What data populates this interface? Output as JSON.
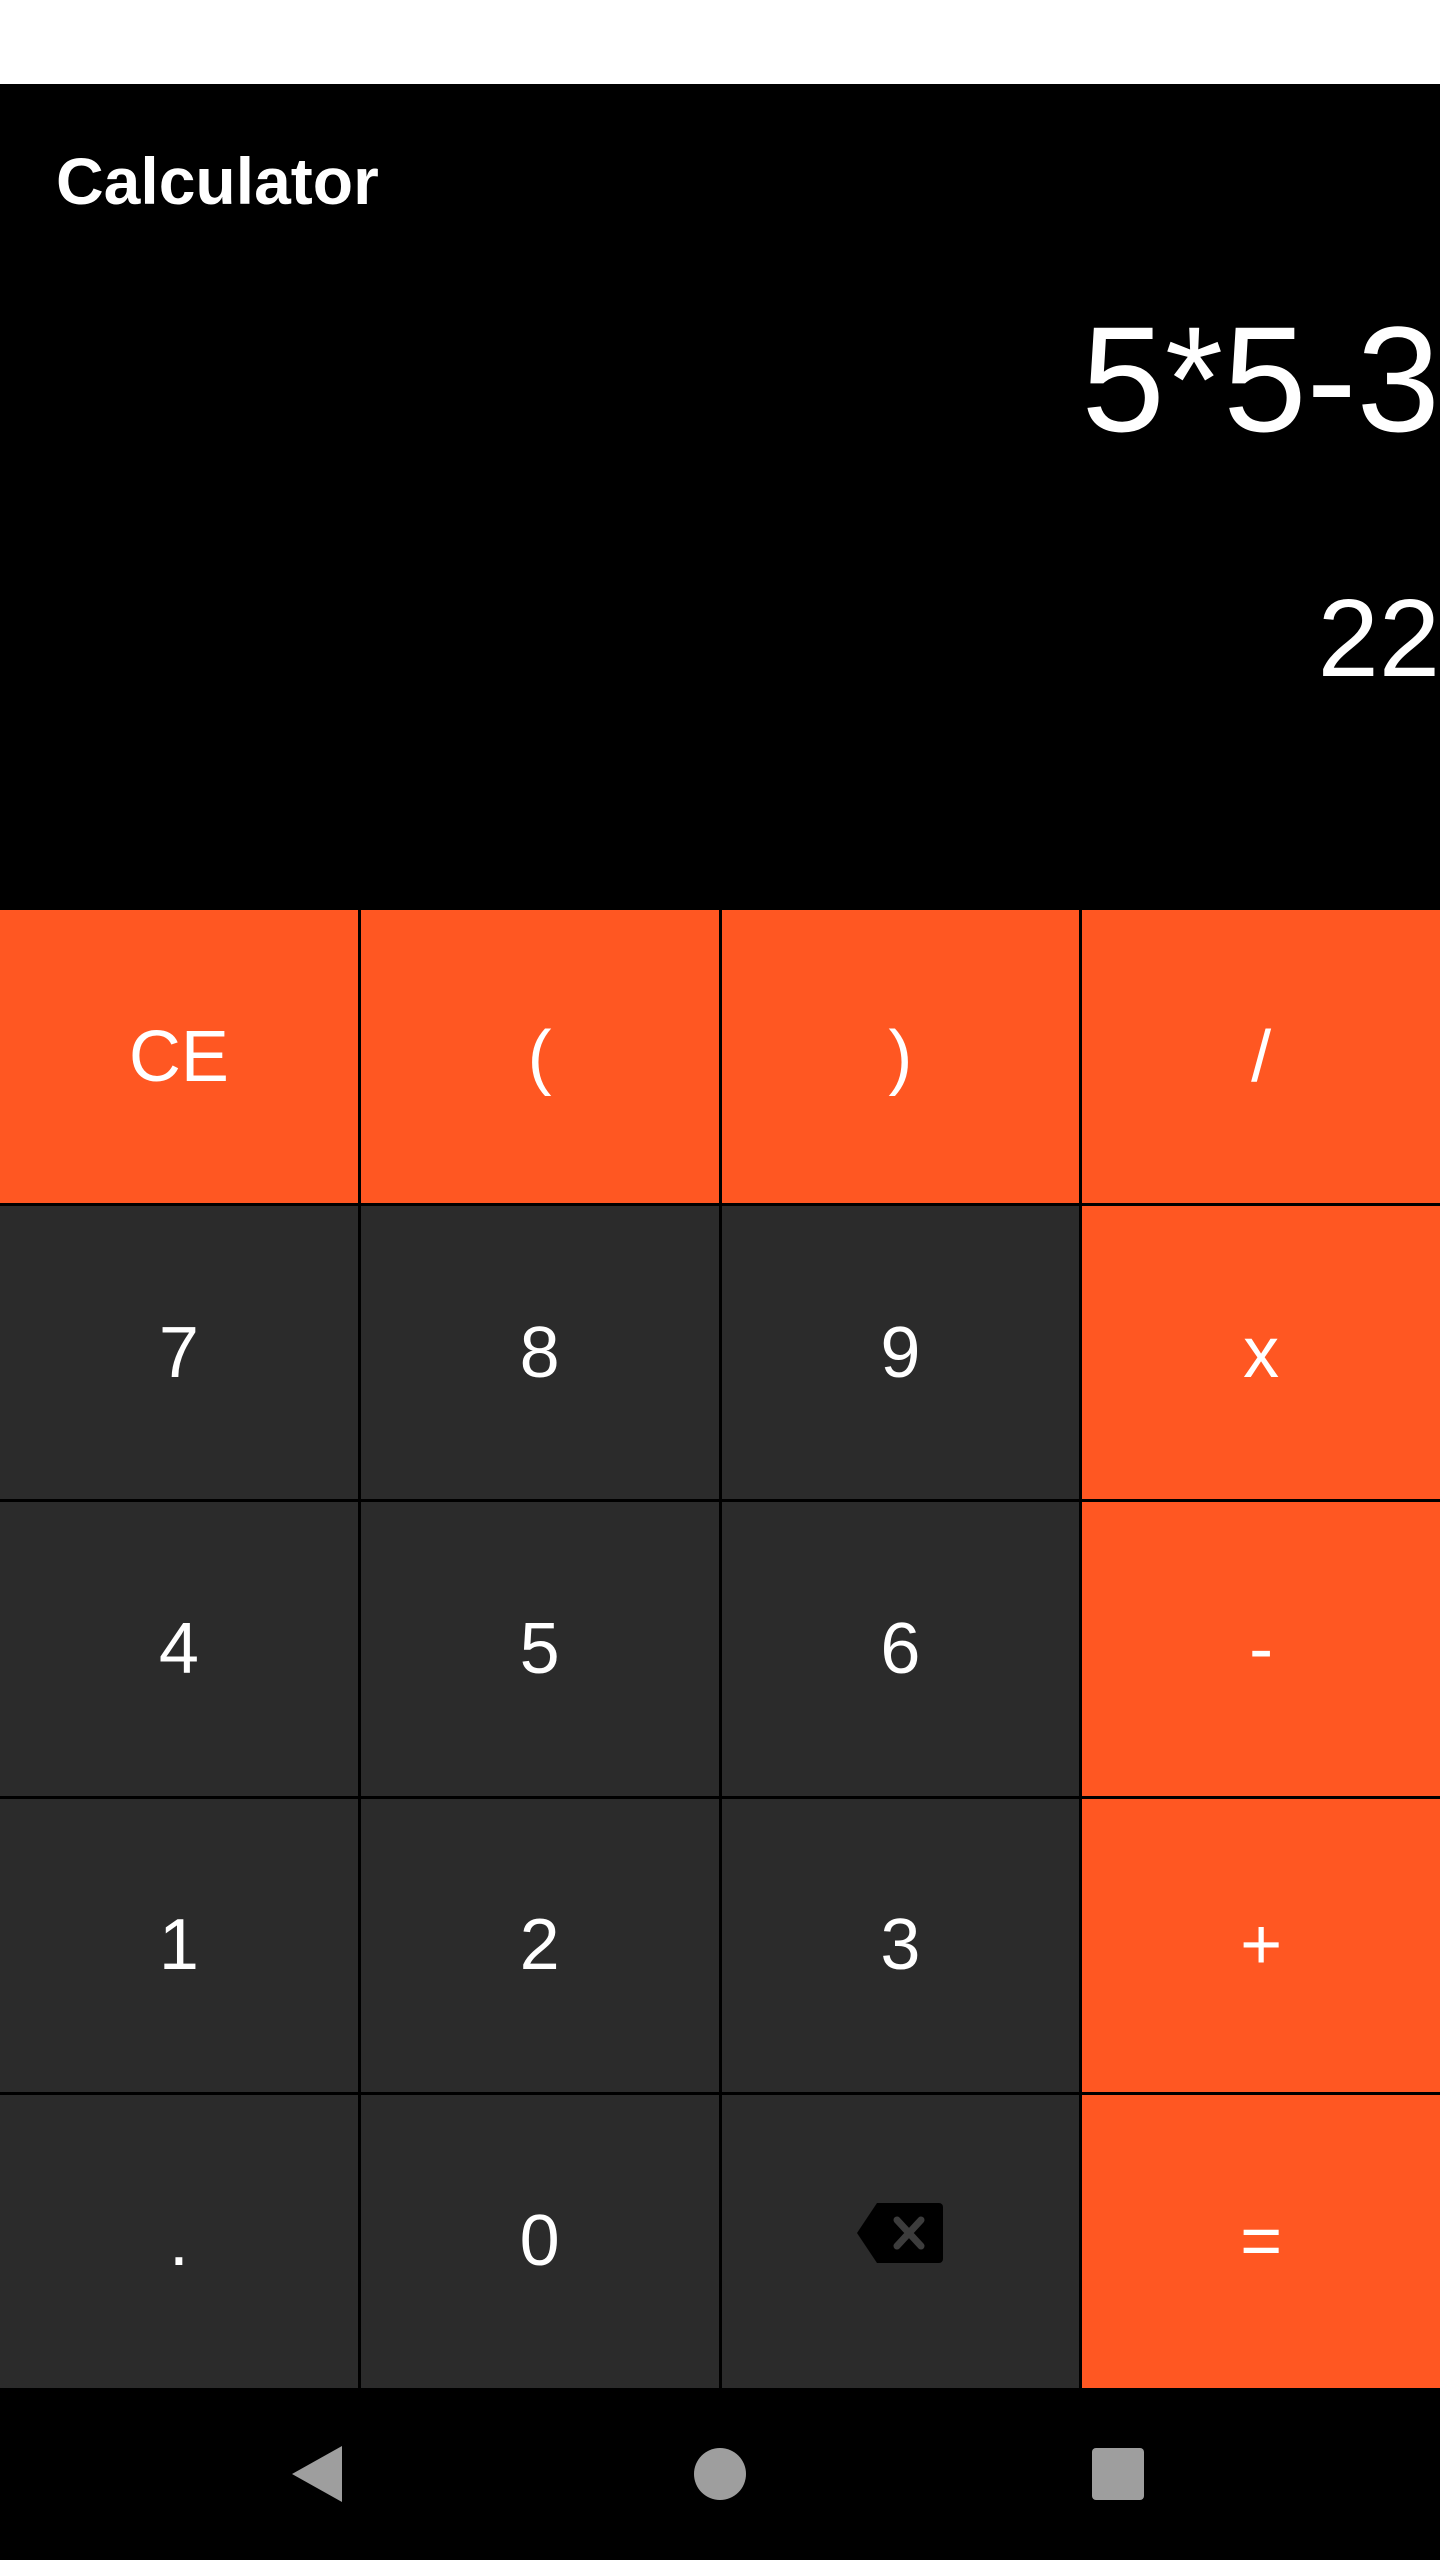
{
  "app": {
    "title": "Calculator"
  },
  "display": {
    "expression": "5*5-3",
    "result": "22"
  },
  "keypad": {
    "rows": [
      [
        {
          "label": "CE",
          "name": "clear-entry-button",
          "kind": "op"
        },
        {
          "label": "(",
          "name": "open-paren-button",
          "kind": "op"
        },
        {
          "label": ")",
          "name": "close-paren-button",
          "kind": "op"
        },
        {
          "label": "/",
          "name": "divide-button",
          "kind": "op"
        }
      ],
      [
        {
          "label": "7",
          "name": "digit-7-button",
          "kind": "num"
        },
        {
          "label": "8",
          "name": "digit-8-button",
          "kind": "num"
        },
        {
          "label": "9",
          "name": "digit-9-button",
          "kind": "num"
        },
        {
          "label": "x",
          "name": "multiply-button",
          "kind": "op"
        }
      ],
      [
        {
          "label": "4",
          "name": "digit-4-button",
          "kind": "num"
        },
        {
          "label": "5",
          "name": "digit-5-button",
          "kind": "num"
        },
        {
          "label": "6",
          "name": "digit-6-button",
          "kind": "num"
        },
        {
          "label": "-",
          "name": "subtract-button",
          "kind": "op"
        }
      ],
      [
        {
          "label": "1",
          "name": "digit-1-button",
          "kind": "num"
        },
        {
          "label": "2",
          "name": "digit-2-button",
          "kind": "num"
        },
        {
          "label": "3",
          "name": "digit-3-button",
          "kind": "num"
        },
        {
          "label": "+",
          "name": "add-button",
          "kind": "op"
        }
      ],
      [
        {
          "label": ".",
          "name": "decimal-button",
          "kind": "num"
        },
        {
          "label": "0",
          "name": "digit-0-button",
          "kind": "num"
        },
        {
          "label": "",
          "name": "backspace-button",
          "kind": "num",
          "icon": "backspace-icon"
        },
        {
          "label": "=",
          "name": "equals-button",
          "kind": "op"
        }
      ]
    ]
  },
  "colors": {
    "accent": "#ff5722",
    "key_dark": "#2b2b2b",
    "background": "#000000",
    "status_bar": "#ffffff"
  },
  "nav": {
    "icons": [
      "back-icon",
      "home-icon",
      "recents-icon"
    ]
  }
}
